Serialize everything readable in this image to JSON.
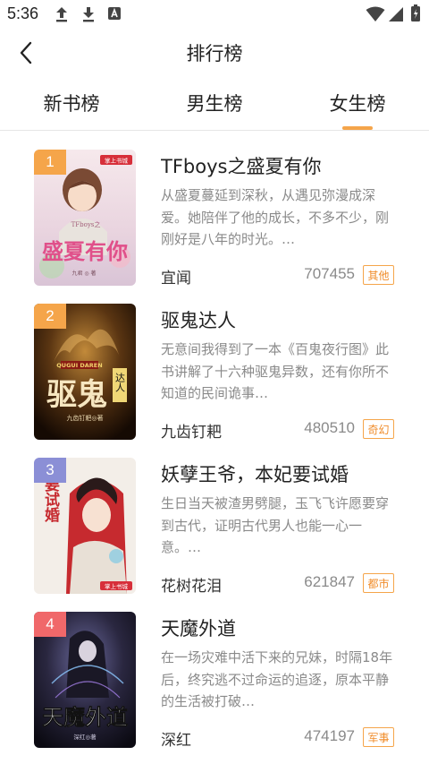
{
  "status_bar": {
    "time": "5:36",
    "icons": [
      "upload-icon",
      "download-icon",
      "font-app-icon",
      "wifi-icon",
      "signal-icon",
      "battery-icon"
    ]
  },
  "header": {
    "title": "排行榜",
    "back_icon": "chevron-left-icon"
  },
  "tabs": [
    {
      "label": "新书榜",
      "active": false
    },
    {
      "label": "男生榜",
      "active": false
    },
    {
      "label": "女生榜",
      "active": true
    }
  ],
  "colors": {
    "accent": "#f5a54a",
    "tag_text": "#f08c2a",
    "rank_1": "#f5a54a",
    "rank_2": "#f5a54a",
    "rank_3": "#8b8fd6",
    "rank_4": "#f0686a"
  },
  "books": [
    {
      "rank": "1",
      "title": "TFboys之盛夏有你",
      "description": "从盛夏蔓延到深秋，从遇见弥漫成深爱。她陪伴了他的成长，不多不少，刚刚好是八年的时光。…",
      "author": "宜闻",
      "count": "707455",
      "tag": "其他",
      "cover": {
        "title_text": "盛夏有你",
        "subtitle_text": "TFboys之",
        "author_text": "九君 ◎ 著",
        "seal_text": "掌上书城"
      }
    },
    {
      "rank": "2",
      "title": "驱鬼达人",
      "description": "无意间我得到了一本《百鬼夜行图》此书讲解了十六种驱鬼异数，还有你所不知道的民间诡事…",
      "author": "九齿钉耙",
      "count": "480510",
      "tag": "奇幻",
      "cover": {
        "title_text": "驱鬼",
        "subtitle_text": "达人",
        "latin_text": "QUGUI DAREN",
        "author_text": "九齿钉耙◎著"
      }
    },
    {
      "rank": "3",
      "title": "妖孽王爷，本妃要试婚",
      "description": "生日当天被渣男劈腿，玉飞飞许愿要穿到古代，证明古代男人也能一心一意。…",
      "author": "花树花泪",
      "count": "621847",
      "tag": "都市",
      "cover": {
        "title_text": "妃要试婚",
        "seal_text": "掌上书城"
      }
    },
    {
      "rank": "4",
      "title": "天魔外道",
      "description": "在一场灾难中活下来的兄妹，时隔18年后，终究逃不过命运的追逐，原本平静的生活被打破…",
      "author": "深红",
      "count": "474197",
      "tag": "军事",
      "cover": {
        "title_text": "天魔外道",
        "author_text": "深红◎著"
      }
    }
  ]
}
